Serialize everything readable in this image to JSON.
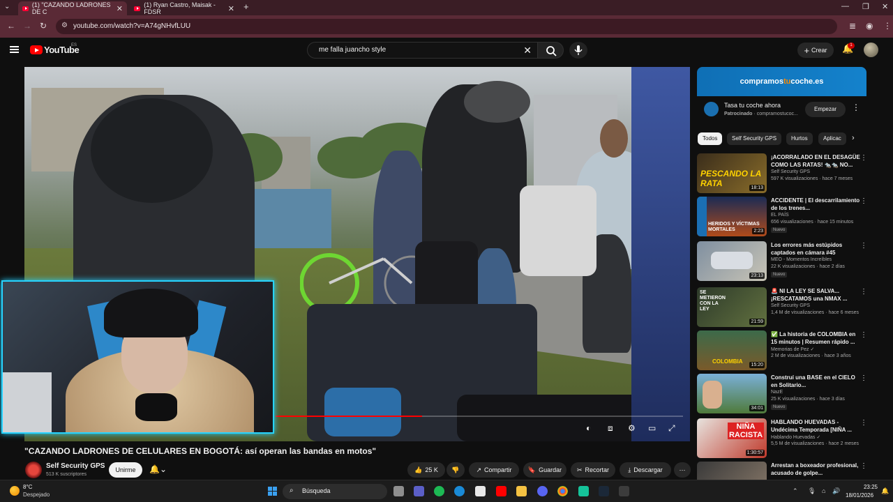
{
  "browser": {
    "tabs": [
      {
        "title": "(1) \"CAZANDO LADRONES DE C"
      },
      {
        "title": "(1) Ryan Castro, Maisak - FDSR"
      }
    ],
    "url": "youtube.com/watch?v=A74gNHvfLUU"
  },
  "youtube": {
    "logo": "YouTube",
    "country": "ES",
    "search_query": "me falla juancho style",
    "create_label": "Crear",
    "notifications_count": "1"
  },
  "video": {
    "title": "\"CAZANDO LADRONES DE CELULARES EN BOGOTÁ: así operan las bandas en motos\"",
    "channel": "Self Security GPS",
    "subscribers": "513 K suscriptores",
    "join_label": "Unirme",
    "likes": "25 K",
    "share_label": "Compartir",
    "save_label": "Guardar",
    "clip_label": "Recortar",
    "download_label": "Descargar",
    "progress": 0.36
  },
  "ad": {
    "banner_prefix": "compramos",
    "banner_accent": "tu",
    "banner_suffix": "coche.es",
    "title": "Tasa tu coche ahora",
    "sponsored": "Patrocinado",
    "domain": "compramostucoc...",
    "cta": "Empezar"
  },
  "chips": [
    "Todos",
    "Self Security GPS",
    "Hurtos",
    "Aplicac"
  ],
  "recommendations": [
    {
      "title": "¡ACORRALADO EN EL DESAGÜE COMO LAS RATAS! 🐀🐀 NO...",
      "channel": "Self Security GPS",
      "meta": "597 K visualizaciones · hace 7 meses",
      "duration": "18:13",
      "thumb_text": "PESCANDO LA RATA",
      "new": ""
    },
    {
      "title": "ACCIDENTE | El descarrilamiento de los trenes...",
      "channel": "EL PAÍS",
      "meta": "656 visualizaciones · hace 15 minutos",
      "duration": "2:23",
      "thumb_text": "HERIDOS Y VÍCTIMAS MORTALES",
      "new": "Nuevo"
    },
    {
      "title": "Los errores más estúpidos captados en cámara #45",
      "channel": "MEO - Momentos Increíbles",
      "meta": "22 K visualizaciones · hace 2 días",
      "duration": "23:13",
      "thumb_text": "",
      "new": "Nuevo"
    },
    {
      "title": "🚨 NI LA LEY SE SALVA... ¡RESCATAMOS una NMAX ...",
      "channel": "Self Security GPS",
      "meta": "1,4 M de visualizaciones · hace 6 meses",
      "duration": "21:59",
      "thumb_text": "SE METIERON CON LA LEY",
      "new": ""
    },
    {
      "title": "✅ La historia de COLOMBIA en 15 minutos | Resumen rápido ...",
      "channel": "Memorias de Pez ✓",
      "meta": "2 M de visualizaciones · hace 3 años",
      "duration": "15:20",
      "thumb_text": "COLOMBIA",
      "new": ""
    },
    {
      "title": "Construí una BASE en el CIELO en Solitario...",
      "channel": "NazE",
      "meta": "25 K visualizaciones · hace 3 días",
      "duration": "34:01",
      "thumb_text": "",
      "new": "Nuevo"
    },
    {
      "title": "HABLANDO HUEVADAS - Undécima Temporada [NIÑA ...",
      "channel": "Hablando Huevadas ✓",
      "meta": "5,5 M de visualizaciones · hace 2 meses",
      "duration": "1:30:57",
      "thumb_text": "NIÑA RACISTA",
      "new": ""
    },
    {
      "title": "Arrestan a boxeador profesional, acusado de golpe...",
      "channel": "",
      "meta": "",
      "duration": "",
      "thumb_text": "",
      "new": ""
    }
  ],
  "taskbar": {
    "temperature": "8°C",
    "weather": "Despejado",
    "search": "Búsqueda",
    "time": "23:25",
    "date": "18/01/2026"
  },
  "colors": {
    "accent": "#ff0000",
    "cam_border": "#27d3ff",
    "tab_active": "#5a2a36"
  }
}
